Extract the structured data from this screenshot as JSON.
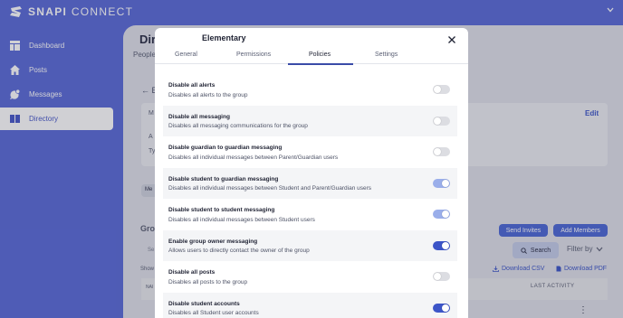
{
  "brand": {
    "name_bold": "SNAPI",
    "name_thin": "CONNECT"
  },
  "sidebar": {
    "items": [
      {
        "label": "Dashboard",
        "icon": "dashboard-icon"
      },
      {
        "label": "Posts",
        "icon": "home-icon"
      },
      {
        "label": "Messages",
        "icon": "messages-icon"
      },
      {
        "label": "Directory",
        "icon": "directory-icon",
        "active": true
      }
    ]
  },
  "background": {
    "title": "Dir",
    "tab_people": "People",
    "back": "← E",
    "card_l1": "M",
    "card_l2": "A",
    "card_l3": "Ty",
    "edit": "Edit",
    "pill": "Me",
    "groups": "Gro",
    "search_placeholder": "Se",
    "show": "Show",
    "col_name": "NAI",
    "send_invites": "Send Invites",
    "add_members": "Add Members",
    "search_btn": "Search",
    "filter_by": "Filter by",
    "download_csv": "Download CSV",
    "download_pdf": "Download PDF",
    "last_activity": "LAST ACTIVITY",
    "row_more": "⋮"
  },
  "modal": {
    "title": "Elementary",
    "tabs": [
      {
        "label": "General"
      },
      {
        "label": "Permissions"
      },
      {
        "label": "Policies",
        "active": true
      },
      {
        "label": "Settings"
      }
    ],
    "policies": [
      {
        "title": "Disable all alerts",
        "desc": "Disables all alerts to the group",
        "state": "off"
      },
      {
        "title": "Disable all messaging",
        "desc": "Disables all messaging communications for the group",
        "state": "off"
      },
      {
        "title": "Disable guardian to guardian messaging",
        "desc": "Disables all individual messages between Parent/Guardian users",
        "state": "off"
      },
      {
        "title": "Disable student to guardian messaging",
        "desc": "Disables all individual messages between Student and Parent/Guardian users",
        "state": "on-light"
      },
      {
        "title": "Disable student to student messaging",
        "desc": "Disables all individual messages between Student users",
        "state": "on-light"
      },
      {
        "title": "Enable group owner messaging",
        "desc": "Allows users to directly contact the owner of the group",
        "state": "on"
      },
      {
        "title": "Disable all posts",
        "desc": "Disables all posts to the group",
        "state": "off"
      },
      {
        "title": "Disable student accounts",
        "desc": "Disables all Student user accounts",
        "state": "on"
      }
    ]
  },
  "colors": {
    "brand": "#5a6bd8",
    "accent": "#3c55c8",
    "toggle_light": "#9aaeea"
  }
}
